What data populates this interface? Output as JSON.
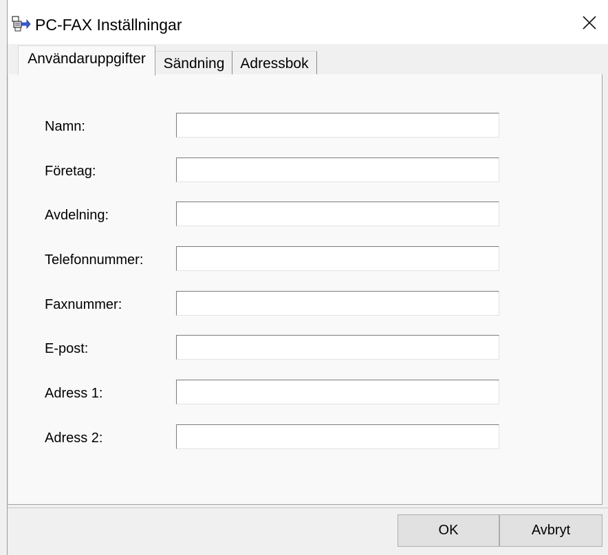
{
  "window": {
    "title": "PC-FAX Inställningar",
    "icon": "pc-fax-icon",
    "close_icon": "close-icon"
  },
  "tabs": [
    {
      "label": "Användaruppgifter",
      "active": true
    },
    {
      "label": "Sändning",
      "active": false
    },
    {
      "label": "Adressbok",
      "active": false
    }
  ],
  "form": {
    "fields": [
      {
        "label": "Namn:",
        "value": "",
        "placeholder": ""
      },
      {
        "label": "Företag:",
        "value": "",
        "placeholder": ""
      },
      {
        "label": "Avdelning:",
        "value": "",
        "placeholder": ""
      },
      {
        "label": "Telefonnummer:",
        "value": "",
        "placeholder": ""
      },
      {
        "label": "Faxnummer:",
        "value": "",
        "placeholder": ""
      },
      {
        "label": "E-post:",
        "value": "",
        "placeholder": ""
      },
      {
        "label": "Adress 1:",
        "value": "",
        "placeholder": ""
      },
      {
        "label": "Adress 2:",
        "value": "",
        "placeholder": ""
      }
    ]
  },
  "buttons": {
    "ok": "OK",
    "cancel": "Avbryt"
  }
}
